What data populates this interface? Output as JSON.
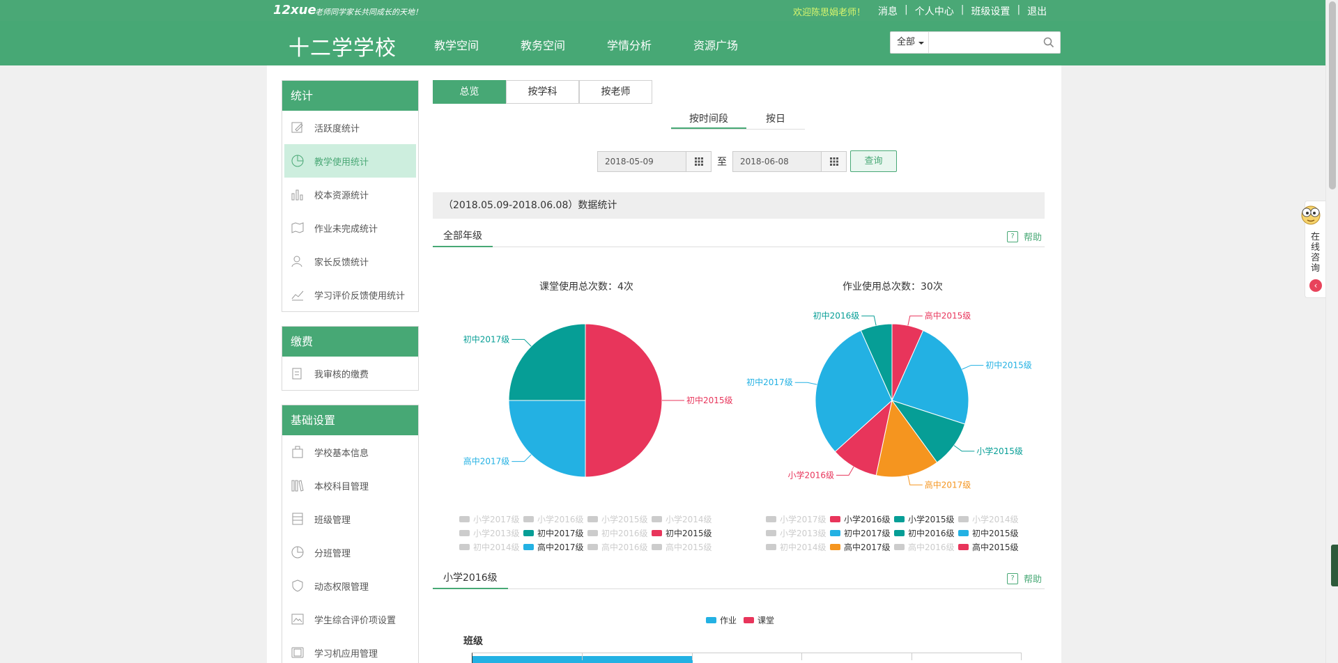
{
  "topbar": {
    "logo_text": "12xue",
    "slogan": "老师同学家长共同成长的天地！",
    "welcome": "欢迎陈思娟老师！",
    "links": [
      "消息",
      "个人中心",
      "班级设置",
      "退出"
    ]
  },
  "header": {
    "school_name": "十二学学校",
    "nav": [
      "教学空间",
      "教务空间",
      "学情分析",
      "资源广场"
    ],
    "search_scope": "全部",
    "search_placeholder": ""
  },
  "sidebar": {
    "sections": [
      {
        "title": "统计",
        "items": [
          {
            "label": "活跃度统计",
            "icon": "edit-icon"
          },
          {
            "label": "教学使用统计",
            "icon": "pie-icon",
            "active": true
          },
          {
            "label": "校本资源统计",
            "icon": "bar-icon"
          },
          {
            "label": "作业未完成统计",
            "icon": "map-icon"
          },
          {
            "label": "家长反馈统计",
            "icon": "user-icon"
          },
          {
            "label": "学习评价反馈使用统计",
            "icon": "trend-icon"
          }
        ]
      },
      {
        "title": "缴费",
        "items": [
          {
            "label": "我审核的缴费",
            "icon": "doc-icon"
          }
        ]
      },
      {
        "title": "基础设置",
        "items": [
          {
            "label": "学校基本信息",
            "icon": "building-icon"
          },
          {
            "label": "本校科目管理",
            "icon": "books-icon"
          },
          {
            "label": "班级管理",
            "icon": "grid-icon"
          },
          {
            "label": "分班管理",
            "icon": "pie-icon"
          },
          {
            "label": "动态权限管理",
            "icon": "shield-icon"
          },
          {
            "label": "学生综合评价项设置",
            "icon": "image-icon"
          },
          {
            "label": "学习机应用管理",
            "icon": "tablet-icon"
          }
        ]
      }
    ]
  },
  "main": {
    "tabs": [
      "总览",
      "按学科",
      "按老师"
    ],
    "active_tab": 0,
    "subtabs": [
      "按时间段",
      "按日"
    ],
    "date_from": "2018-05-09",
    "date_sep": "至",
    "date_to": "2018-06-08",
    "query_label": "查询",
    "stat_header": "（2018.05.09-2018.06.08）数据统计",
    "section1_label": "全部年级",
    "help_label": "帮助",
    "section2_label": "小学2016级",
    "class_label": "班级"
  },
  "colors": {
    "brand": "#47a875",
    "red": "#e8355b",
    "blue": "#23b1e3",
    "teal": "#069e96",
    "orange": "#f5951f",
    "disabled": "#cccccc"
  },
  "chart_data": [
    {
      "type": "pie",
      "title": "课堂使用总次数：4次",
      "slices": [
        {
          "name": "初中2015级",
          "value": 2,
          "color": "#e8355b"
        },
        {
          "name": "高中2017级",
          "value": 1,
          "color": "#23b1e3"
        },
        {
          "name": "初中2017级",
          "value": 1,
          "color": "#069e96"
        }
      ],
      "legend": [
        {
          "name": "小学2017级",
          "on": false
        },
        {
          "name": "小学2016级",
          "on": false
        },
        {
          "name": "小学2015级",
          "on": false
        },
        {
          "name": "小学2014级",
          "on": false
        },
        {
          "name": "小学2013级",
          "on": false
        },
        {
          "name": "初中2017级",
          "on": true,
          "color": "#069e96"
        },
        {
          "name": "初中2016级",
          "on": false
        },
        {
          "name": "初中2015级",
          "on": true,
          "color": "#e8355b"
        },
        {
          "name": "初中2014级",
          "on": false
        },
        {
          "name": "高中2017级",
          "on": true,
          "color": "#23b1e3"
        },
        {
          "name": "高中2016级",
          "on": false
        },
        {
          "name": "高中2015级",
          "on": false
        }
      ]
    },
    {
      "type": "pie",
      "title": "作业使用总次数：30次",
      "slices": [
        {
          "name": "高中2015级",
          "value": 2,
          "color": "#e8355b"
        },
        {
          "name": "初中2015级",
          "value": 7,
          "color": "#23b1e3"
        },
        {
          "name": "小学2015级",
          "value": 3,
          "color": "#069e96"
        },
        {
          "name": "高中2017级",
          "value": 4,
          "color": "#f5951f"
        },
        {
          "name": "小学2016级",
          "value": 3,
          "color": "#e8355b"
        },
        {
          "name": "初中2017级",
          "value": 9,
          "color": "#23b1e3"
        },
        {
          "name": "初中2016级",
          "value": 2,
          "color": "#069e96"
        }
      ],
      "legend": [
        {
          "name": "小学2017级",
          "on": false
        },
        {
          "name": "小学2016级",
          "on": true,
          "color": "#e8355b"
        },
        {
          "name": "小学2015级",
          "on": true,
          "color": "#069e96"
        },
        {
          "name": "小学2014级",
          "on": false
        },
        {
          "name": "小学2013级",
          "on": false
        },
        {
          "name": "初中2017级",
          "on": true,
          "color": "#23b1e3"
        },
        {
          "name": "初中2016级",
          "on": true,
          "color": "#069e96"
        },
        {
          "name": "初中2015级",
          "on": true,
          "color": "#23b1e3"
        },
        {
          "name": "初中2014级",
          "on": false
        },
        {
          "name": "高中2017级",
          "on": true,
          "color": "#f5951f"
        },
        {
          "name": "高中2016级",
          "on": false
        },
        {
          "name": "高中2015级",
          "on": true,
          "color": "#e8355b"
        }
      ]
    },
    {
      "type": "bar",
      "legend": [
        {
          "name": "作业",
          "color": "#23b1e3"
        },
        {
          "name": "课堂",
          "color": "#e8355b"
        }
      ],
      "ylabel": "班级"
    }
  ],
  "consult": {
    "text": "在线咨询"
  }
}
